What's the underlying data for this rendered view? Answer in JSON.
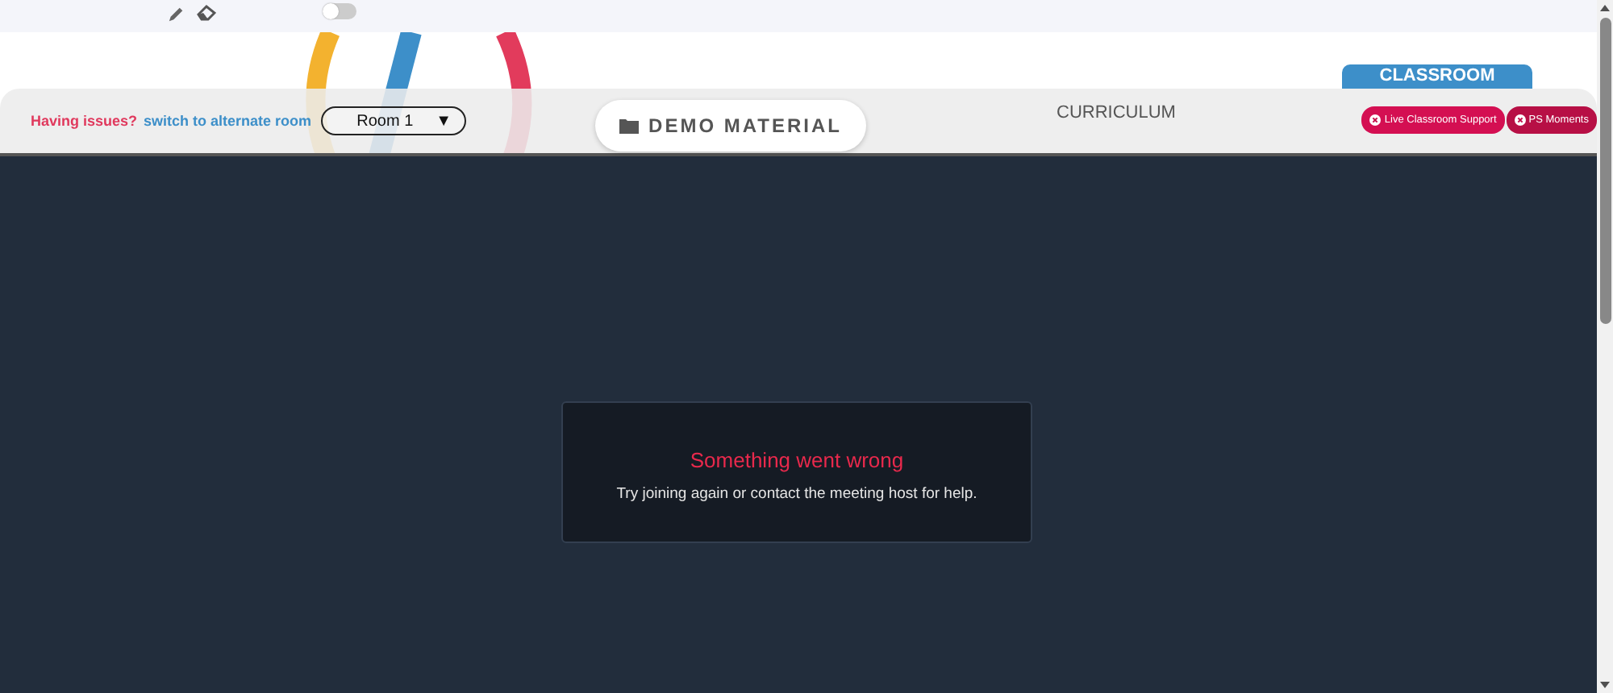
{
  "toolbar": {
    "toggle": {
      "on": false
    }
  },
  "header": {
    "issue_text": "Having issues?",
    "switch_link": "switch to alternate room",
    "room_select": {
      "value": "Room 1",
      "caret": "▼"
    },
    "demo_button": "DEMO MATERIAL",
    "curriculum_link": "CURRICULUM",
    "classroom_tab": "CLASSROOM",
    "buttons": [
      {
        "label": "Live Classroom Support"
      },
      {
        "label": "PS Moments"
      }
    ]
  },
  "error": {
    "title": "Something went wrong",
    "message": "Try joining again or contact the meeting host for help."
  }
}
